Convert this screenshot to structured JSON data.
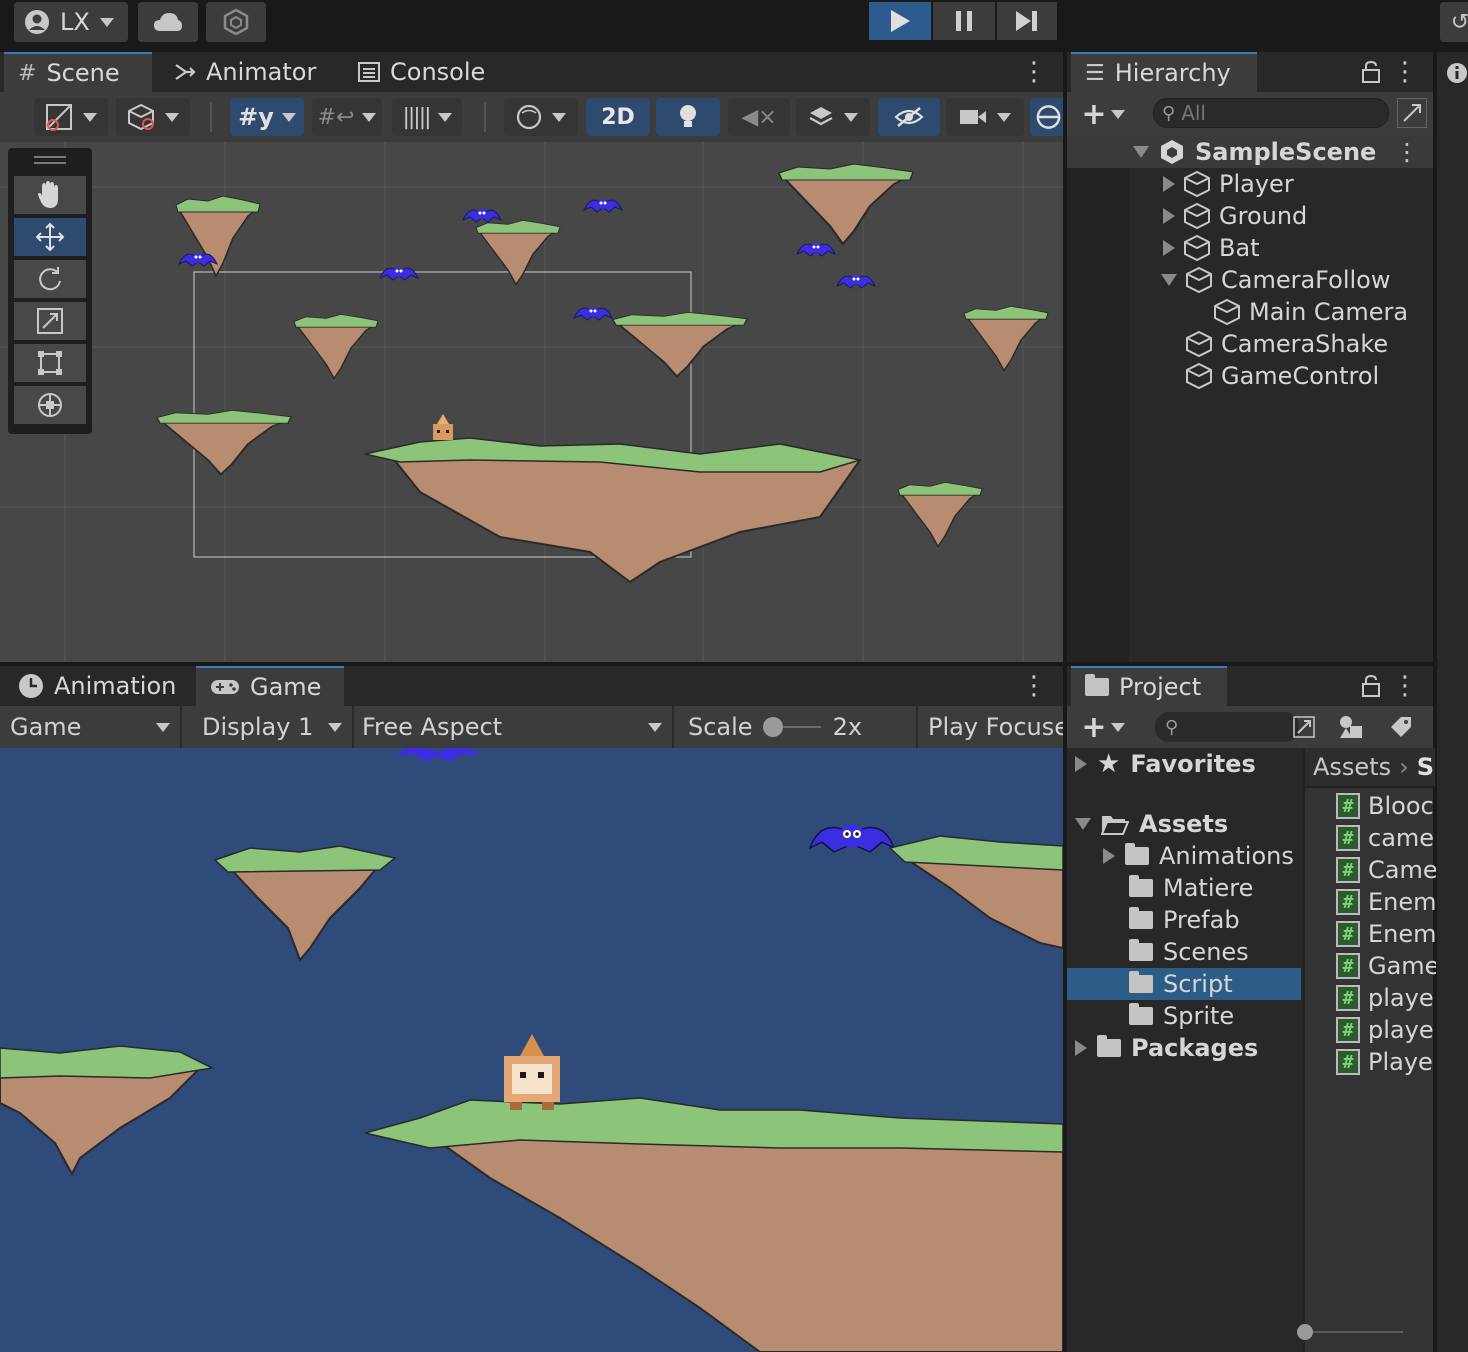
{
  "topbar": {
    "account_label": "LX",
    "icons": [
      "account-icon",
      "cloud-icon",
      "collab-icon",
      "play-icon",
      "pause-icon",
      "step-icon"
    ]
  },
  "scene_panel": {
    "tabs": [
      {
        "label": "Scene",
        "icon": "grid-hash-icon"
      },
      {
        "label": "Animator",
        "icon": "animator-icon"
      },
      {
        "label": "Console",
        "icon": "console-icon"
      }
    ],
    "toolbar": {
      "toggle_2d_label": "2D"
    },
    "tools": [
      "hand-tool-icon",
      "move-tool-icon",
      "rotate-tool-icon",
      "scale-tool-icon",
      "rect-tool-icon",
      "transform-tool-icon"
    ]
  },
  "hierarchy": {
    "tab_label": "Hierarchy",
    "search_placeholder": "All",
    "scene_name": "SampleScene",
    "items": [
      {
        "label": "Player"
      },
      {
        "label": "Ground"
      },
      {
        "label": "Bat"
      },
      {
        "label": "CameraFollow"
      },
      {
        "label": "Main Camera"
      },
      {
        "label": "CameraShake"
      },
      {
        "label": "GameControl"
      }
    ]
  },
  "game_panel": {
    "tabs": [
      {
        "label": "Animation",
        "icon": "clock-icon"
      },
      {
        "label": "Game",
        "icon": "gamepad-icon"
      }
    ],
    "toolbar": {
      "mode": "Game",
      "display": "Display 1",
      "aspect": "Free Aspect",
      "scale_label": "Scale",
      "scale_value": "2x",
      "play_focus": "Play Focuse"
    }
  },
  "project": {
    "tab_label": "Project",
    "favorites_label": "Favorites",
    "assets_label": "Assets",
    "folders": [
      "Animations",
      "Matiere",
      "Prefab",
      "Scenes",
      "Script",
      "Sprite"
    ],
    "selected_folder": "Script",
    "packages_label": "Packages",
    "breadcrumb": {
      "root": "Assets",
      "next": "S"
    },
    "scripts": [
      "Blooc",
      "came",
      "Came",
      "Enem",
      "Enem",
      "Game",
      "playe",
      "playe",
      "Playe"
    ]
  },
  "colors": {
    "accent": "#3a79bb",
    "selection": "#2c5d87",
    "game_bg": "#2f4b7a",
    "scene_bg": "#474747",
    "grass": "#8cc47a",
    "rock": "#b88c70",
    "bat": "#3a2ee0"
  }
}
